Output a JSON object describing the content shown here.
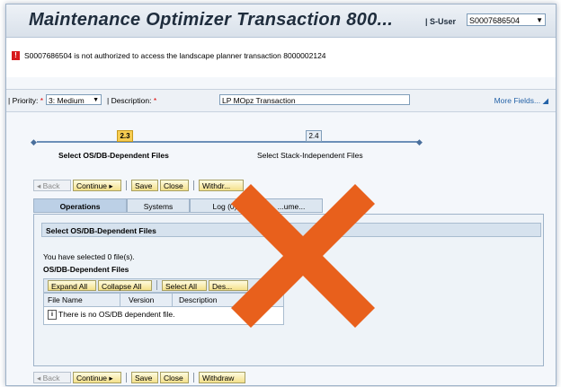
{
  "header": {
    "title": "Maintenance Optimizer Transaction 800...",
    "suser_label": "| S-User",
    "suser_value": "S0007686504"
  },
  "message": {
    "text": "S0007686504 is not authorized to access the landscape planner transaction 8000002124"
  },
  "fields": {
    "priority_label": "| Priority:",
    "priority_value": "3: Medium",
    "description_label": "| Description:",
    "description_value": "LP MOpz Transaction",
    "more_fields": "More Fields..."
  },
  "roadmap": {
    "steps": [
      {
        "number": "2.3",
        "label": "Select OS/DB-Dependent Files"
      },
      {
        "number": "2.4",
        "label": "Select Stack-Independent Files"
      }
    ]
  },
  "toolbar": {
    "back": "Back",
    "continue": "Continue",
    "save": "Save",
    "close": "Close",
    "withdraw": "Withdraw",
    "withdraw_top": "Withdr..."
  },
  "tabs": [
    {
      "label": "Operations"
    },
    {
      "label": "Systems"
    },
    {
      "label": "Log (0)"
    },
    {
      "label": "...ume..."
    }
  ],
  "panel": {
    "heading": "Select OS/DB-Dependent Files",
    "selected_text": "You have selected 0 file(s).",
    "sub_heading": "OS/DB-Dependent Files",
    "buttons": {
      "expand_all": "Expand All",
      "collapse_all": "Collapse All",
      "select_all": "Select All",
      "deselect": "Des..."
    },
    "columns": [
      "File Name",
      "Version",
      "Description"
    ],
    "empty_message": "There is no OS/DB dependent file."
  },
  "colors": {
    "overlay_x": "#e8601c",
    "error_red": "#d7191c",
    "active_step": "#f7cd52"
  }
}
